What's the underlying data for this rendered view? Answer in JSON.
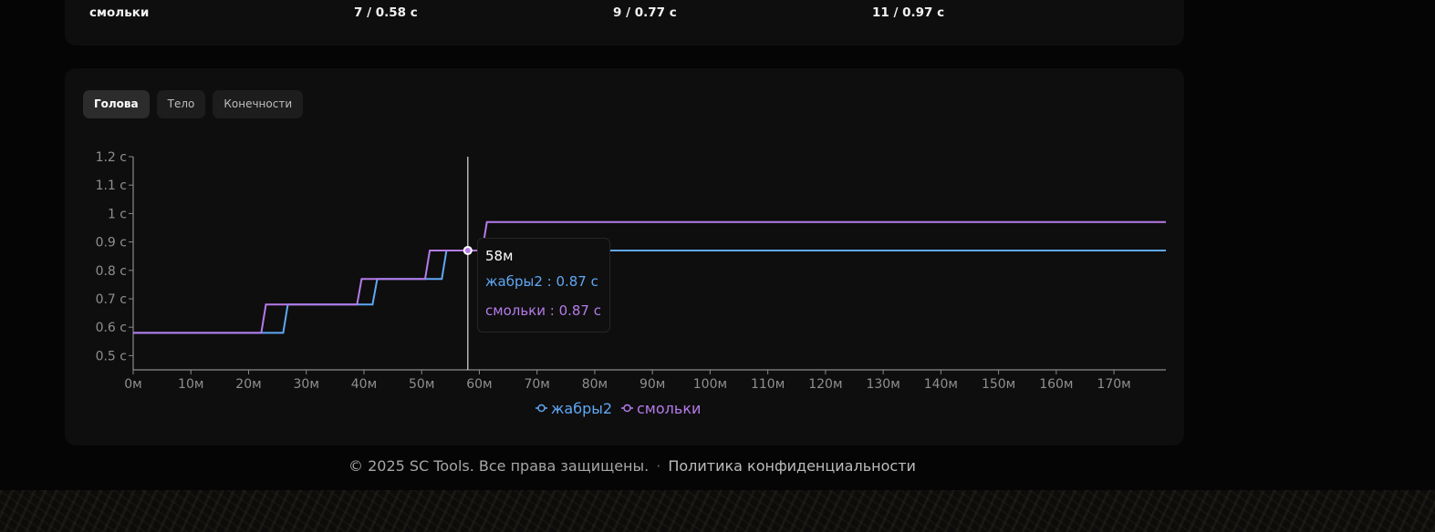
{
  "table_row": {
    "name": "смольки",
    "cells": [
      "7 / 0.58 с",
      "9 / 0.77 с",
      "11 / 0.97 с"
    ]
  },
  "tabs": [
    {
      "label": "Голова",
      "active": true
    },
    {
      "label": "Тело",
      "active": false
    },
    {
      "label": "Конечности",
      "active": false
    }
  ],
  "tooltip": {
    "x_label": "58м",
    "series_a": "жабры2 : 0.87 с",
    "series_b": "смольки : 0.87 с"
  },
  "footer": {
    "copyright": "© 2025 SC Tools. Все права защищены.",
    "separator": "·",
    "privacy_link": "Политика конфиденциальности"
  },
  "colors": {
    "series_a": "#5fa8f5",
    "series_b": "#b57bea",
    "axis": "#8a8a8a",
    "crosshair": "#cfcfcf"
  },
  "chart_data": {
    "type": "line",
    "xlim": [
      0,
      179
    ],
    "ylim": [
      0.45,
      1.2
    ],
    "x_ticks": [
      0,
      10,
      20,
      30,
      40,
      50,
      60,
      70,
      80,
      90,
      100,
      110,
      120,
      130,
      140,
      150,
      160,
      170
    ],
    "x_tick_labels": [
      "0м",
      "10м",
      "20м",
      "30м",
      "40м",
      "50м",
      "60м",
      "70м",
      "80м",
      "90м",
      "100м",
      "110м",
      "120м",
      "130м",
      "140м",
      "150м",
      "160м",
      "170м"
    ],
    "y_ticks": [
      0.5,
      0.6,
      0.7,
      0.8,
      0.9,
      1.0,
      1.1,
      1.2
    ],
    "y_tick_labels": [
      "0.5 с",
      "0.6 с",
      "0.7 с",
      "0.8 с",
      "0.9 с",
      "1 с",
      "1.1 с",
      "1.2 с"
    ],
    "legend_position": "bottom-center",
    "crosshair_x": 58,
    "series": [
      {
        "name": "жабры2",
        "color": "#5fa8f5",
        "points": [
          [
            0,
            0.58
          ],
          [
            26,
            0.58
          ],
          [
            26.8,
            0.68
          ],
          [
            41.5,
            0.68
          ],
          [
            42.3,
            0.77
          ],
          [
            53.5,
            0.77
          ],
          [
            54.3,
            0.87
          ],
          [
            179,
            0.87
          ]
        ]
      },
      {
        "name": "смольки",
        "color": "#b57bea",
        "points": [
          [
            0,
            0.58
          ],
          [
            22.2,
            0.58
          ],
          [
            23,
            0.68
          ],
          [
            38.8,
            0.68
          ],
          [
            39.6,
            0.77
          ],
          [
            50.6,
            0.77
          ],
          [
            51.4,
            0.87
          ],
          [
            60.5,
            0.87
          ],
          [
            61.3,
            0.97
          ],
          [
            179,
            0.97
          ]
        ]
      }
    ]
  }
}
